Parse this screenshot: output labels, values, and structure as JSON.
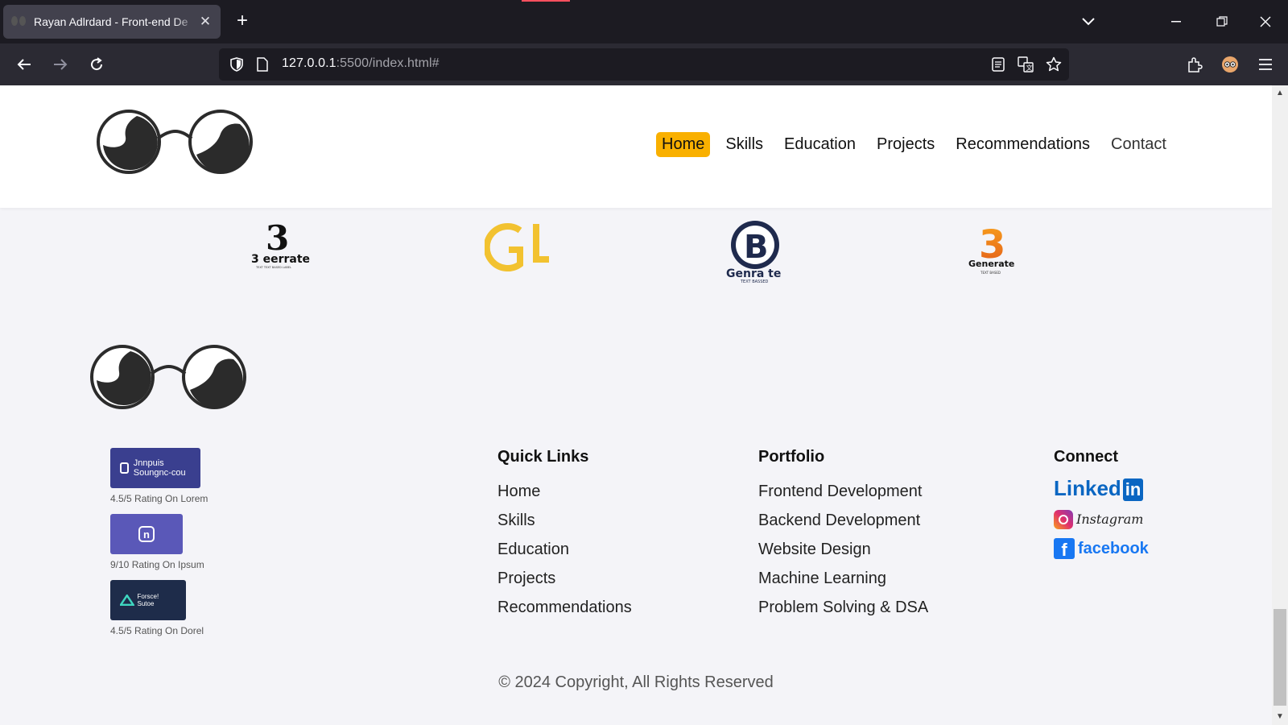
{
  "browser": {
    "tab_title": "Rayan Adlrdard - Front-end De",
    "tab_close": "✕",
    "new_tab": "+",
    "url_host": "127.0.0.1",
    "url_rest": ":5500/index.html#"
  },
  "nav": {
    "items": [
      {
        "label": "Home",
        "active": true
      },
      {
        "label": "Skills",
        "active": false
      },
      {
        "label": "Education",
        "active": false
      },
      {
        "label": "Projects",
        "active": false
      },
      {
        "label": "Recommendations",
        "active": false
      },
      {
        "label": "Contact",
        "active": false
      }
    ]
  },
  "partners": [
    {
      "name": "3 eerrate",
      "sub": "TEXT TEXT BASED LABEL"
    },
    {
      "name": "Gl",
      "sub": ""
    },
    {
      "name": "Genra te",
      "sub": "TEXT BASSED"
    },
    {
      "name": "Generate",
      "sub": "TEXT BASED"
    }
  ],
  "badges": [
    {
      "name": "Jnnpuis Soungnc-cou",
      "caption": "4.5/5 Rating On Lorem",
      "color": "#3a3f8f"
    },
    {
      "name": "n",
      "caption": "9/10 Rating On Ipsum",
      "color": "#5a58b8"
    },
    {
      "name": "Forsce! Sutoe",
      "caption": "4.5/5 Rating On Dorel",
      "color": "#1e2c4a"
    }
  ],
  "quick_links": {
    "title": "Quick Links",
    "items": [
      "Home",
      "Skills",
      "Education",
      "Projects",
      "Recommendations"
    ]
  },
  "portfolio": {
    "title": "Portfolio",
    "items": [
      "Frontend Development",
      "Backend Development",
      "Website Design",
      "Machine Learning",
      "Problem Solving & DSA"
    ]
  },
  "connect": {
    "title": "Connect",
    "linkedin": "Linked",
    "linkedin_in": "in",
    "instagram": "Instagram",
    "facebook": "facebook"
  },
  "copyright": "© 2024 Copyright, All Rights Reserved",
  "colors": {
    "accent": "#f9b000",
    "page_bg": "#f4f4f8",
    "chrome_bg": "#1c1b22"
  }
}
